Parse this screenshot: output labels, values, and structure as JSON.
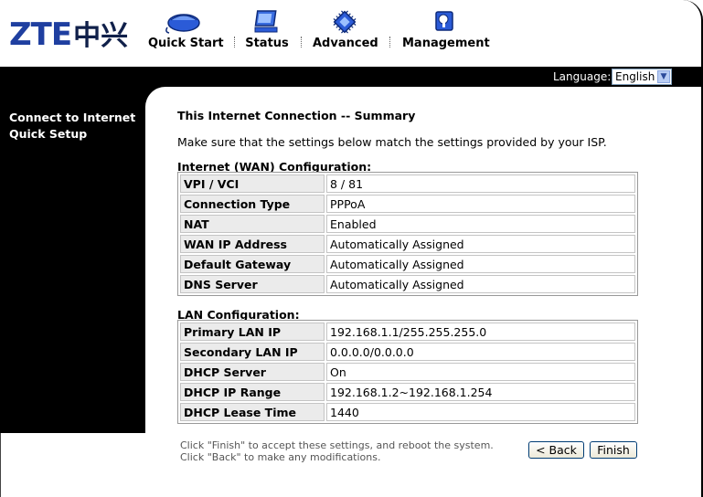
{
  "brand": {
    "logo_latin": "ZTE",
    "logo_cn": "中兴"
  },
  "nav": [
    {
      "label": "Quick Start",
      "icon": "mouse-icon"
    },
    {
      "label": "Status",
      "icon": "monitor-icon"
    },
    {
      "label": "Advanced",
      "icon": "chip-icon"
    },
    {
      "label": "Management",
      "icon": "key-lock-icon"
    }
  ],
  "language": {
    "label": "Language:",
    "selected": "English"
  },
  "sidebar": {
    "items": [
      {
        "label": "Connect to Internet"
      },
      {
        "label": "Quick Setup"
      }
    ]
  },
  "main": {
    "title": "This Internet Connection -- Summary",
    "intro": "Make sure that the settings below match the settings provided by your ISP.",
    "wan": {
      "title": "Internet (WAN) Configuration:",
      "rows": [
        {
          "key": "VPI / VCI",
          "value": "8 / 81"
        },
        {
          "key": "Connection Type",
          "value": "PPPoA"
        },
        {
          "key": "NAT",
          "value": "Enabled"
        },
        {
          "key": "WAN IP Address",
          "value": "Automatically Assigned"
        },
        {
          "key": "Default Gateway",
          "value": "Automatically Assigned"
        },
        {
          "key": "DNS Server",
          "value": "Automatically Assigned"
        }
      ]
    },
    "lan": {
      "title": "LAN Configuration:",
      "rows": [
        {
          "key": "Primary LAN IP",
          "value": "192.168.1.1/255.255.255.0"
        },
        {
          "key": "Secondary LAN IP",
          "value": "0.0.0.0/0.0.0.0"
        },
        {
          "key": "DHCP Server",
          "value": "On"
        },
        {
          "key": "DHCP IP Range",
          "value": "192.168.1.2~192.168.1.254"
        },
        {
          "key": "DHCP Lease Time",
          "value": "1440"
        }
      ]
    },
    "note_line1": "Click \"Finish\" to accept these settings, and reboot the system.",
    "note_line2": "Click \"Back\" to make any modifications.",
    "back_label": "< Back",
    "finish_label": "Finish"
  },
  "colors": {
    "accent": "#1f3fa0",
    "bar": "#000000"
  }
}
